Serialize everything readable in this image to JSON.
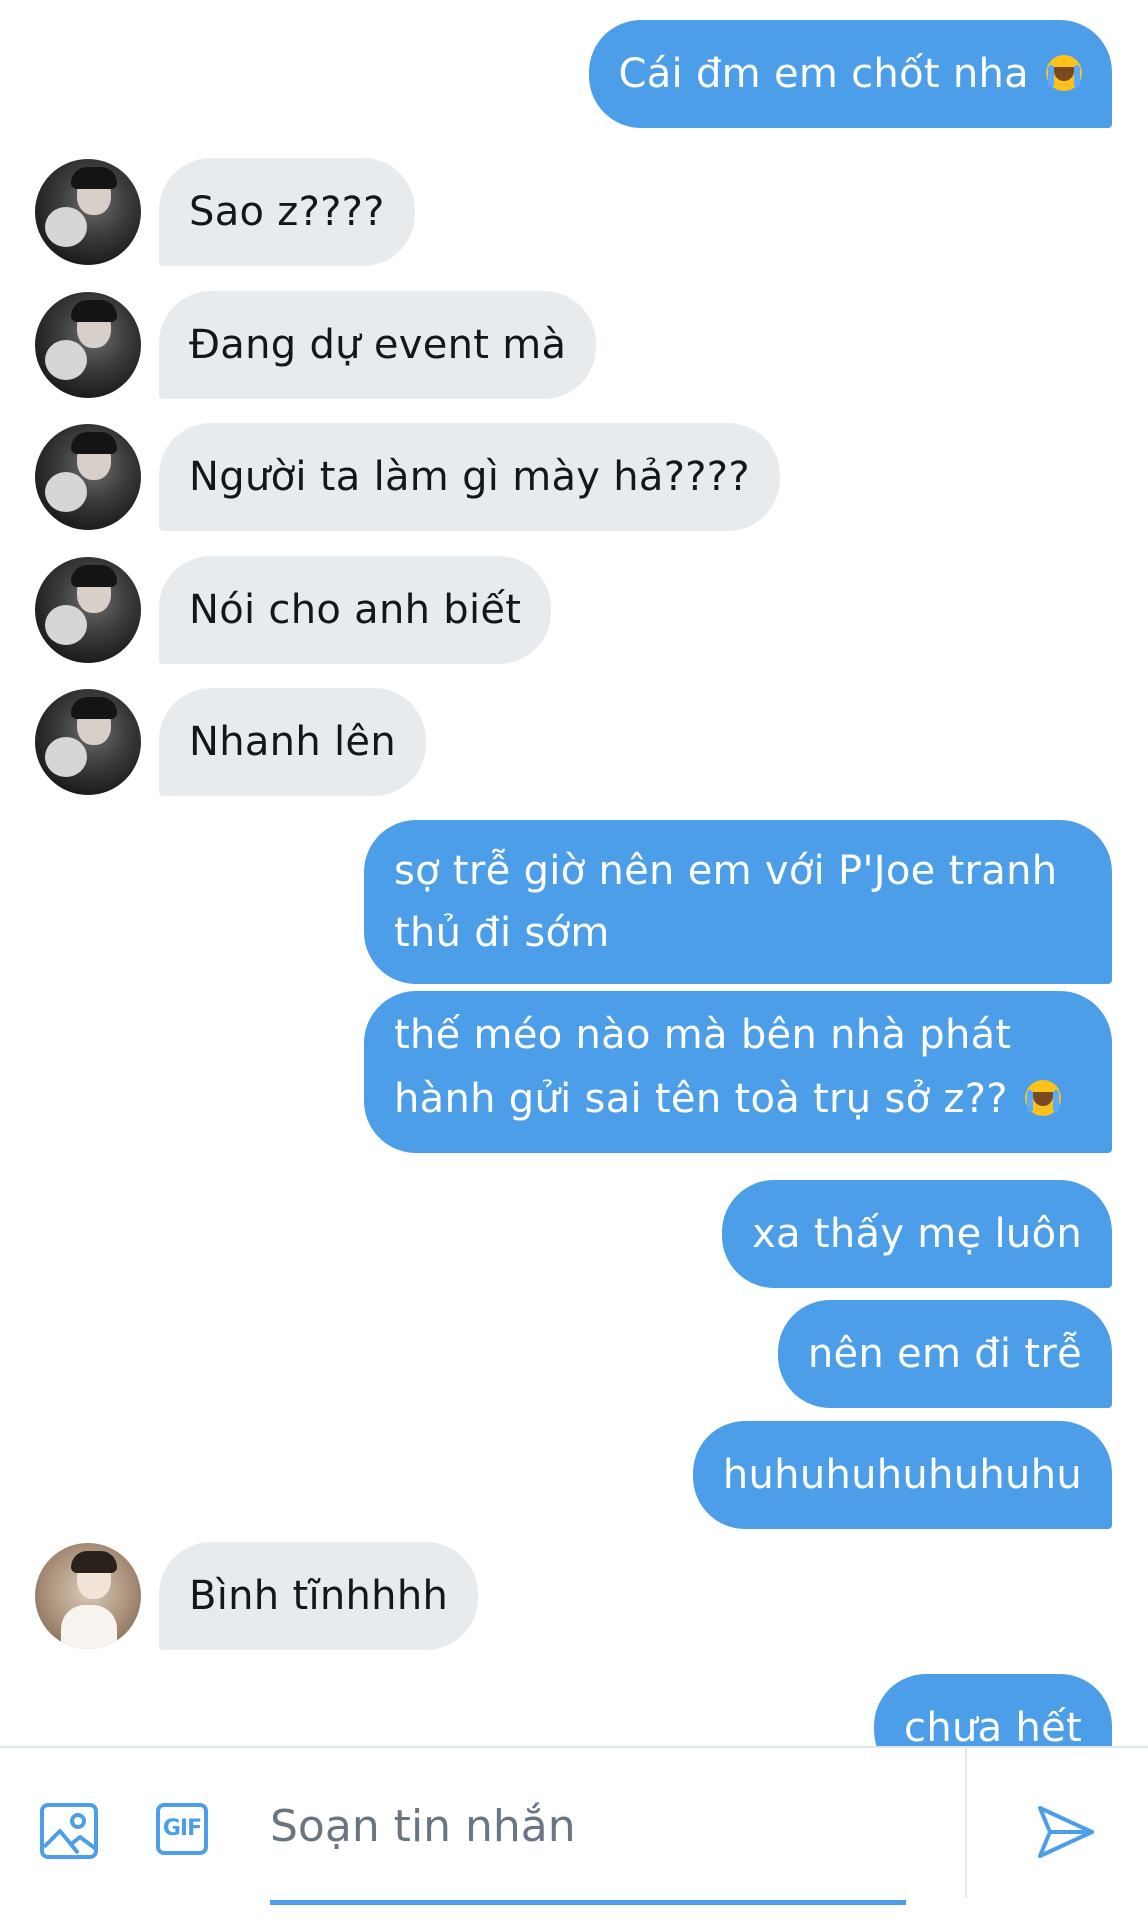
{
  "colors": {
    "outgoing_bubble": "#4d9ee8",
    "incoming_bubble": "#e8ebee",
    "accent": "#4d9ee8"
  },
  "messages": [
    {
      "direction": "out",
      "text": "Cái đm em chốt nha",
      "emoji": "loudly-crying-face"
    },
    {
      "direction": "in",
      "text": "Sao z????"
    },
    {
      "direction": "in",
      "text": "Đang dự event mà"
    },
    {
      "direction": "in",
      "text": "Người ta làm gì mày hả????"
    },
    {
      "direction": "in",
      "text": "Nói cho anh biết"
    },
    {
      "direction": "in",
      "text": "Nhanh lên"
    },
    {
      "direction": "out",
      "text": "sợ trễ giờ nên em với P'Joe tranh thủ đi sớm"
    },
    {
      "direction": "out",
      "text": "thế méo nào mà bên nhà phát hành gửi sai tên toà trụ sở z??",
      "emoji": "loudly-crying-face"
    },
    {
      "direction": "out",
      "text": "xa thấy mẹ luôn"
    },
    {
      "direction": "out",
      "text": "nên em đi trễ"
    },
    {
      "direction": "out",
      "text": "huhuhuhuhuhuhu"
    },
    {
      "direction": "in",
      "text": "Bình tĩnhhhh"
    },
    {
      "direction": "out",
      "text": "chưa hết"
    }
  ],
  "composer": {
    "placeholder": "Soạn tin nhắn",
    "value": "",
    "image_icon": "image-icon",
    "gif_label": "GIF",
    "send_icon": "send-icon"
  }
}
